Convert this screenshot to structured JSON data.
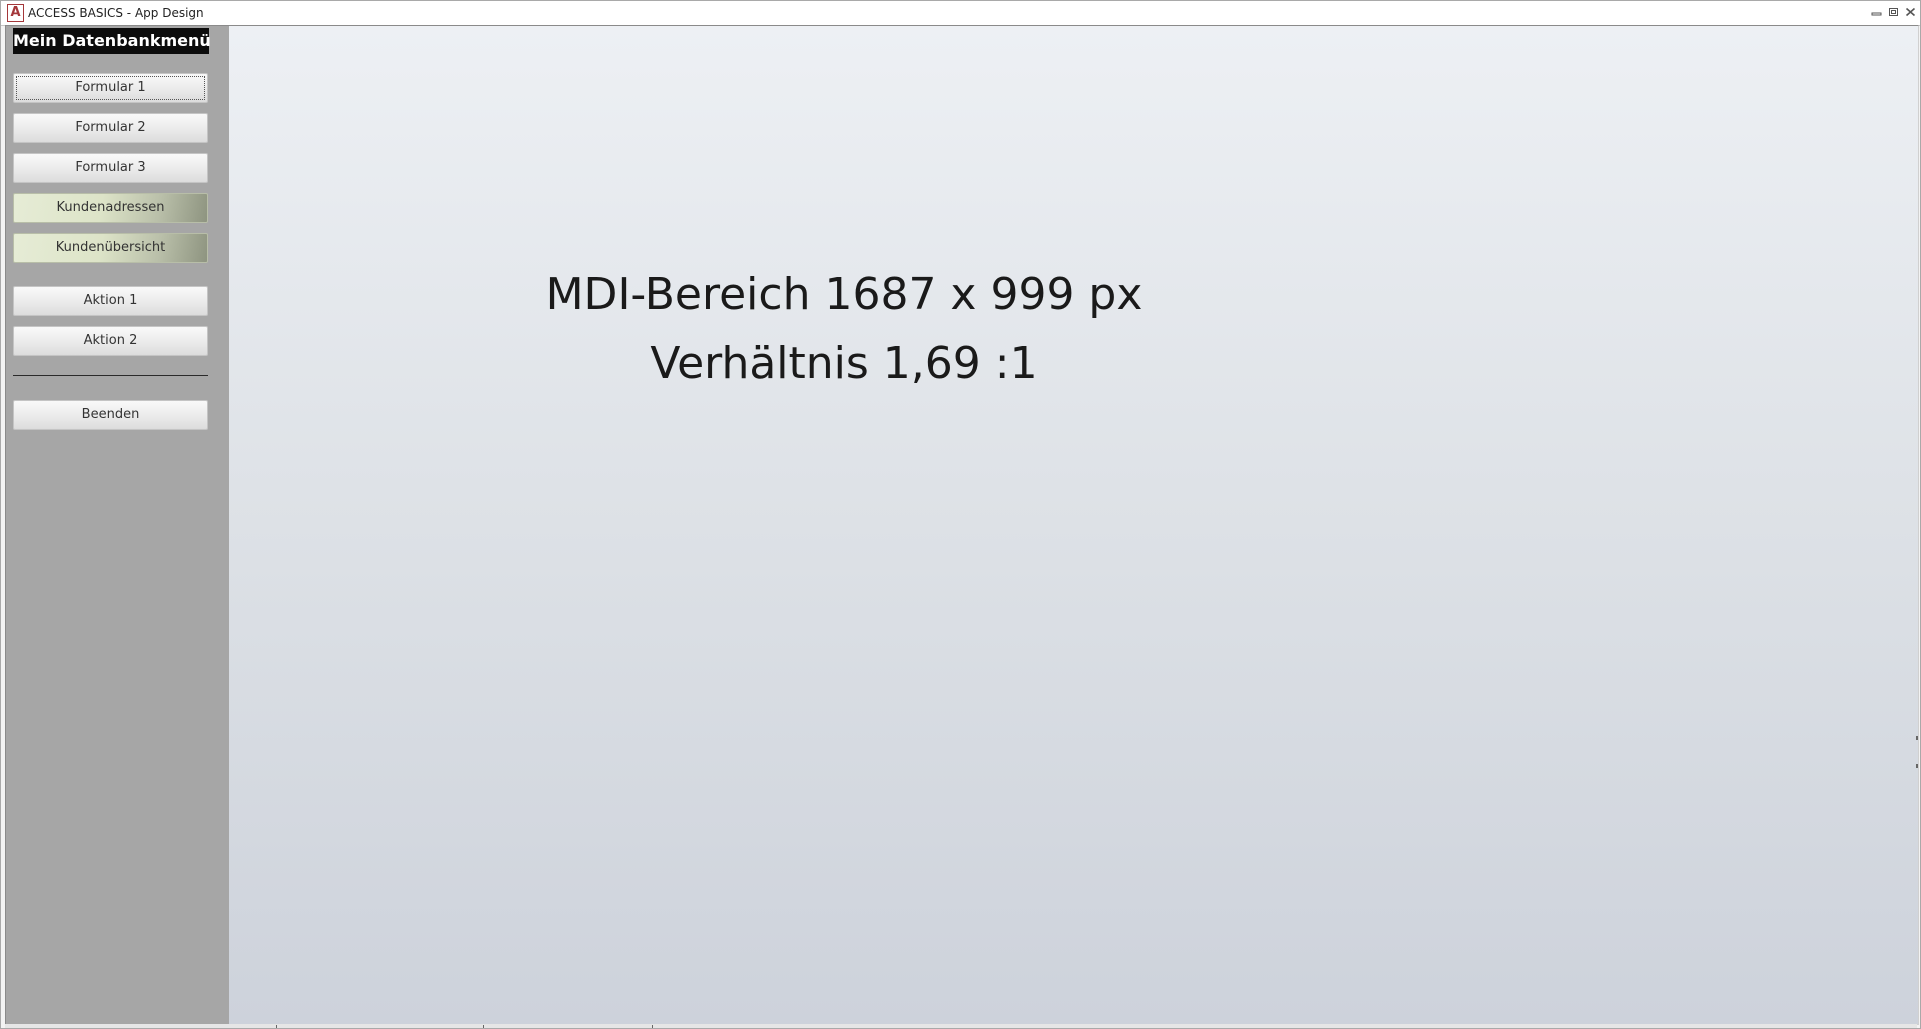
{
  "window": {
    "title": "ACCESS BASICS - App Design",
    "app_icon_letter": "A",
    "accent_color": "#a4373a"
  },
  "sidebar": {
    "title": "Mein Datenbankmenü",
    "buttons": [
      {
        "label": "Formular 1"
      },
      {
        "label": "Formular 2"
      },
      {
        "label": "Formular 3"
      },
      {
        "label": "Kundenadressen"
      },
      {
        "label": "Kundenübersicht"
      },
      {
        "label": "Aktion 1"
      },
      {
        "label": "Aktion 2"
      }
    ],
    "exit_label": "Beenden",
    "background_color": "#a6a6a6"
  },
  "mdi": {
    "line1": "MDI-Bereich 1687 x 999 px",
    "line2": "Verhältnis 1,69 :1"
  },
  "icons": {
    "minimize": "minimize-icon",
    "restore": "restore-icon",
    "close": "close-icon"
  }
}
